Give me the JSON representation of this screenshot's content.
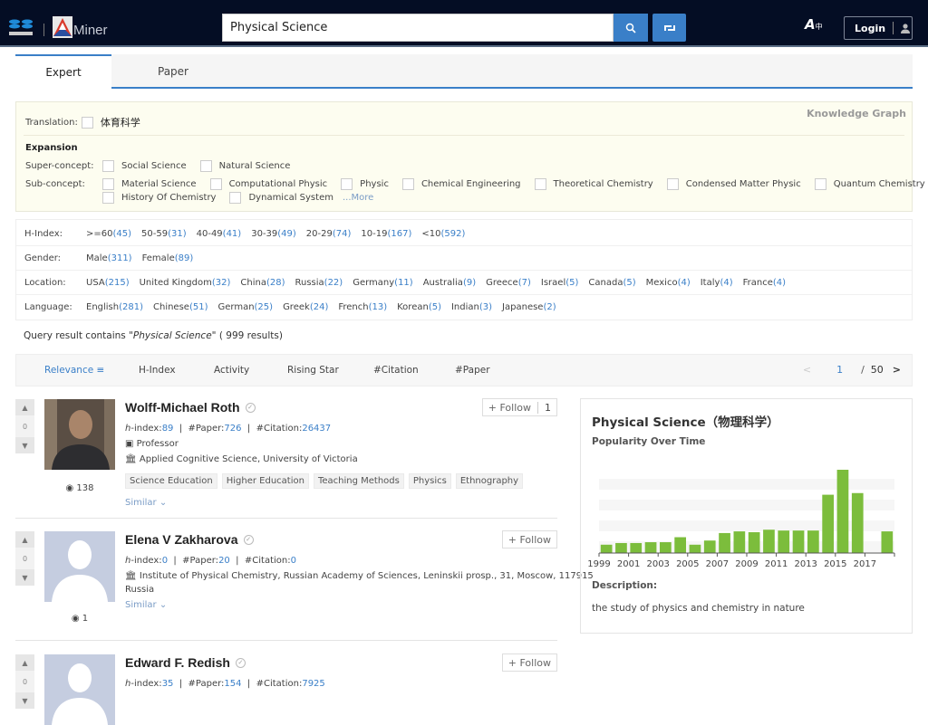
{
  "header": {
    "logo_left": "ACEMAP logo",
    "logo_brand": "Miner",
    "search_value": "Physical Science",
    "search_icon": "search-icon",
    "switch_icon": "retweet-icon",
    "lang_icon": "translate-icon",
    "login_label": "Login",
    "user_icon": "user-icon"
  },
  "tabs": [
    {
      "label": "Expert",
      "active": true
    },
    {
      "label": "Paper",
      "active": false
    }
  ],
  "expansion": {
    "translation_label": "Translation:",
    "translation_value": "体育科学",
    "knowledge_graph": "Knowledge Graph",
    "heading": "Expansion",
    "super_label": "Super-concept:",
    "super_concepts": [
      "Social Science",
      "Natural Science"
    ],
    "sub_label": "Sub-concept:",
    "sub_concepts_row1": [
      "Material Science",
      "Computational Physic",
      "Physic",
      "Chemical Engineering",
      "Theoretical Chemistry",
      "Condensed Matter Physic",
      "Quantum Chemistry"
    ],
    "sub_concepts_row2": [
      "History Of Chemistry",
      "Dynamical System"
    ],
    "more_label": "...More"
  },
  "filters": {
    "hindex": {
      "label": "H-Index:",
      "items": [
        {
          "t": ">=60",
          "c": "(45)"
        },
        {
          "t": "50-59",
          "c": "(31)"
        },
        {
          "t": "40-49",
          "c": "(41)"
        },
        {
          "t": "30-39",
          "c": "(49)"
        },
        {
          "t": "20-29",
          "c": "(74)"
        },
        {
          "t": "10-19",
          "c": "(167)"
        },
        {
          "t": "<10",
          "c": "(592)"
        }
      ]
    },
    "gender": {
      "label": "Gender:",
      "items": [
        {
          "t": "Male",
          "c": "(311)"
        },
        {
          "t": "Female",
          "c": "(89)"
        }
      ]
    },
    "location": {
      "label": "Location:",
      "items": [
        {
          "t": "USA",
          "c": "(215)"
        },
        {
          "t": "United Kingdom",
          "c": "(32)"
        },
        {
          "t": "China",
          "c": "(28)"
        },
        {
          "t": "Russia",
          "c": "(22)"
        },
        {
          "t": "Germany",
          "c": "(11)"
        },
        {
          "t": "Australia",
          "c": "(9)"
        },
        {
          "t": "Greece",
          "c": "(7)"
        },
        {
          "t": "Israel",
          "c": "(5)"
        },
        {
          "t": "Canada",
          "c": "(5)"
        },
        {
          "t": "Mexico",
          "c": "(4)"
        },
        {
          "t": "Italy",
          "c": "(4)"
        },
        {
          "t": "France",
          "c": "(4)"
        }
      ]
    },
    "language": {
      "label": "Language:",
      "items": [
        {
          "t": "English",
          "c": "(281)"
        },
        {
          "t": "Chinese",
          "c": "(51)"
        },
        {
          "t": "German",
          "c": "(25)"
        },
        {
          "t": "Greek",
          "c": "(24)"
        },
        {
          "t": "French",
          "c": "(13)"
        },
        {
          "t": "Korean",
          "c": "(5)"
        },
        {
          "t": "Indian",
          "c": "(3)"
        },
        {
          "t": "Japanese",
          "c": "(2)"
        }
      ]
    }
  },
  "query": {
    "prefix": "Query result contains \"",
    "term": "Physical Science",
    "suffix": "\" ( 999 results)"
  },
  "sort": {
    "options": [
      "Relevance ≡",
      "H-Index",
      "Activity",
      "Rising Star",
      "#Citation",
      "#Paper"
    ],
    "active": "Relevance ≡",
    "prev": "<",
    "page": "1",
    "sep": "/",
    "total": "50",
    "next": ">"
  },
  "experts": [
    {
      "name": "Wolff-Michael Roth",
      "votes": "0",
      "views": "138",
      "hindex_label": "h",
      "hindex_suffix": "-index:",
      "hindex": "89",
      "paper_label": "#Paper:",
      "paper": "726",
      "citation_label": "#Citation:",
      "citation": "26437",
      "position": "Professor",
      "affiliation": "Applied Cognitive Science, University of Victoria",
      "tags": [
        "Science Education",
        "Higher Education",
        "Teaching Methods",
        "Physics",
        "Ethnography"
      ],
      "similar": "Similar ⌄",
      "follow": "+ Follow",
      "follow_count": "1"
    },
    {
      "name": "Elena V Zakharova",
      "votes": "0",
      "views": "1",
      "hindex_label": "h",
      "hindex_suffix": "-index:",
      "hindex": "0",
      "paper_label": "#Paper:",
      "paper": "20",
      "citation_label": "#Citation:",
      "citation": "0",
      "affiliation": "Institute of Physical Chemistry, Russian Academy of Sciences, Leninskii prosp., 31, Moscow, 117915",
      "affiliation2": "Russia",
      "similar": "Similar ⌄",
      "follow": "+ Follow"
    },
    {
      "name": "Edward F. Redish",
      "votes": "0",
      "hindex_label": "h",
      "hindex_suffix": "-index:",
      "hindex": "35",
      "paper_label": "#Paper:",
      "paper": "154",
      "citation_label": "#Citation:",
      "citation": "7925",
      "follow": "+ Follow"
    }
  ],
  "panel": {
    "title": "Physical Science（物理科学）",
    "subtitle": "Popularity Over Time",
    "description_label": "Description:",
    "description": "the study of physics and chemistry in nature"
  },
  "chart_data": {
    "type": "bar",
    "title": "Popularity Over Time",
    "categories": [
      "1999",
      "2000",
      "2001",
      "2002",
      "2003",
      "2004",
      "2005",
      "2006",
      "2007",
      "2008",
      "2009",
      "2010",
      "2011",
      "2012",
      "2013",
      "2014",
      "2015",
      "2016",
      "2017",
      "2018"
    ],
    "values": [
      10,
      12,
      12,
      13,
      13,
      19,
      10,
      15,
      24,
      26,
      25,
      28,
      27,
      27,
      27,
      70,
      100,
      72,
      0,
      26
    ],
    "tick_labels": [
      "1999",
      "2001",
      "2003",
      "2005",
      "2007",
      "2009",
      "2011",
      "2013",
      "2015",
      "2017"
    ],
    "color": "#7cbd3c",
    "xlabel": "",
    "ylabel": "",
    "ylim": [
      0,
      100
    ],
    "grid": true
  }
}
